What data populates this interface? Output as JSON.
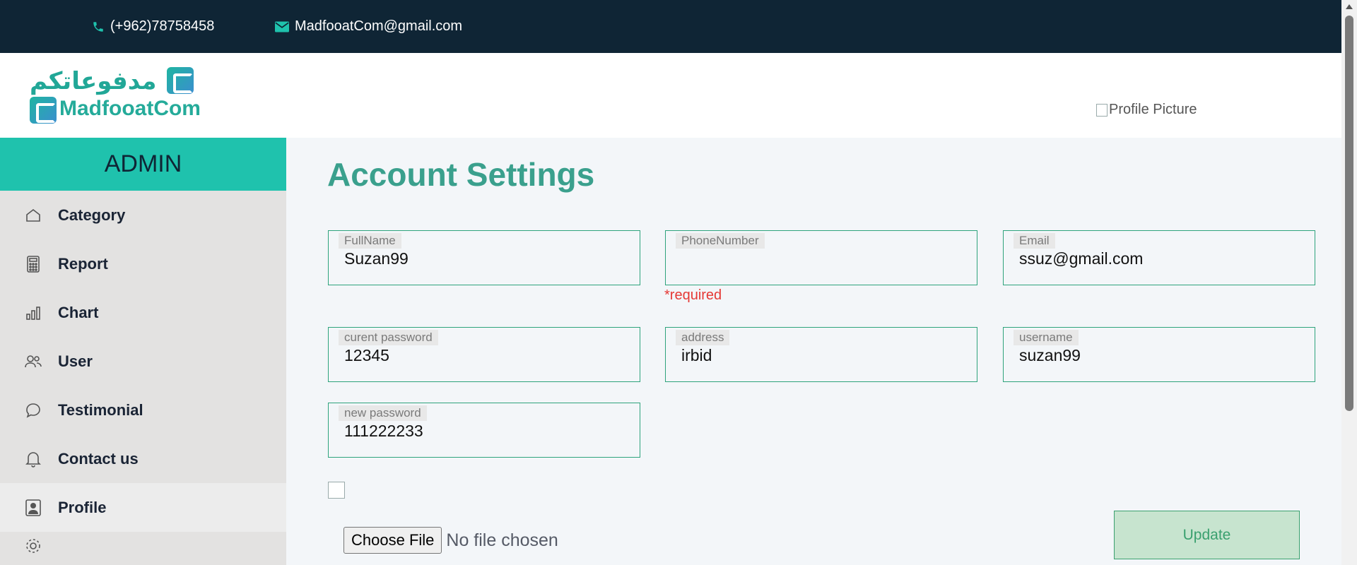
{
  "topbar": {
    "phone": "(+962)78758458",
    "email": "MadfooatCom@gmail.com"
  },
  "header": {
    "logo_ar": "مدفوعاتكم",
    "logo_en": "MadfooatCom",
    "profile_alt": "Profile Picture"
  },
  "sidebar": {
    "brand": "ADMIN",
    "items": [
      {
        "label": "Category",
        "icon": "home-icon"
      },
      {
        "label": "Report",
        "icon": "calculator-icon"
      },
      {
        "label": "Chart",
        "icon": "bar-chart-icon"
      },
      {
        "label": "User",
        "icon": "users-icon"
      },
      {
        "label": "Testimonial",
        "icon": "chat-bubble-icon"
      },
      {
        "label": "Contact us",
        "icon": "bell-icon"
      },
      {
        "label": "Profile",
        "icon": "profile-icon"
      }
    ]
  },
  "main": {
    "title": "Account Settings",
    "fields": {
      "fullname": {
        "label": "FullName",
        "value": "Suzan99"
      },
      "phone": {
        "label": "PhoneNumber",
        "value": ""
      },
      "email": {
        "label": "Email",
        "value": "ssuz@gmail.com"
      },
      "current_password": {
        "label": "curent password",
        "value": "12345"
      },
      "address": {
        "label": "address",
        "value": "irbid"
      },
      "username": {
        "label": "username",
        "value": "suzan99"
      },
      "new_password": {
        "label": "new password",
        "value": "111222233"
      }
    },
    "required_msg": "*required",
    "file_button": "Choose File",
    "file_status": "No file chosen",
    "update_label": "Update"
  },
  "colors": {
    "topbar": "#0f2535",
    "accent": "#1fc2ad",
    "title": "#3aa08d",
    "error": "#e53935"
  }
}
